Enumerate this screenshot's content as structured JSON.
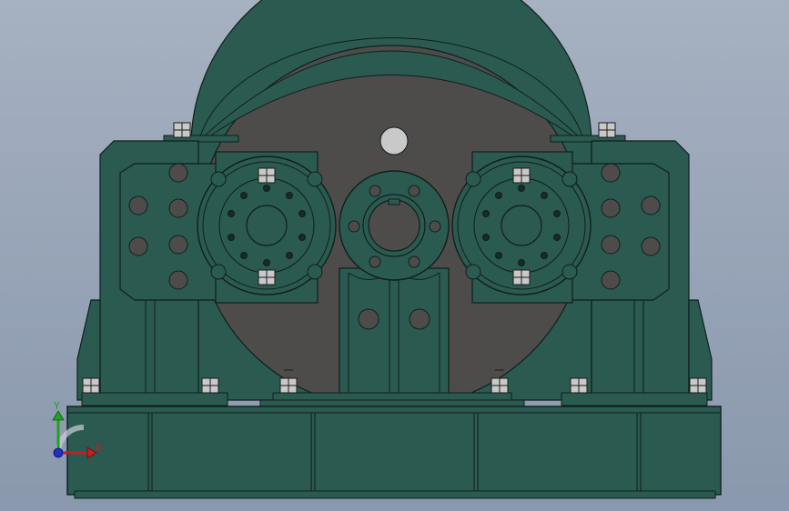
{
  "viewport": {
    "background_top": "#a6b1c1",
    "background_bottom": "#8a98ad"
  },
  "model": {
    "part_color": "#2b5a51",
    "edge_color": "#0f1f1c",
    "disc_color": "#4e4c4a",
    "hole_color": "#4e4c4a",
    "bolt_color": "#c9c9c9"
  },
  "triad": {
    "x_label": "X",
    "y_label": "Y",
    "x_color": "#c41f1f",
    "y_color": "#1fa21f",
    "z_color": "#1f2fc4"
  }
}
